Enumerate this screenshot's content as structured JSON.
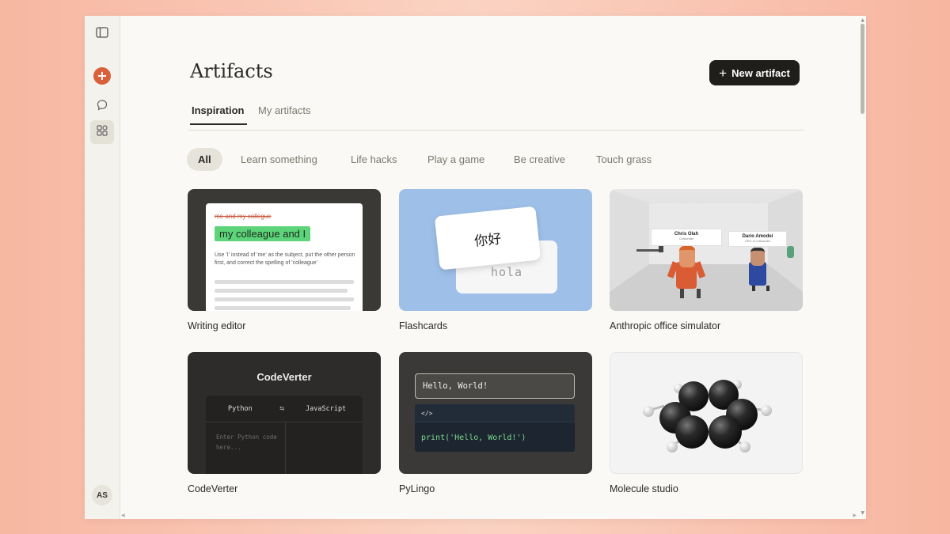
{
  "sidebar": {
    "toggle_icon": "sidebar-toggle-icon",
    "new_chat_icon": "plus-icon",
    "chats_icon": "chat-bubble-icon",
    "artifacts_icon": "artifacts-grid-icon",
    "avatar_initials": "AS",
    "accent": "#d9603d"
  },
  "header": {
    "title": "Artifacts",
    "new_button_label": "New artifact"
  },
  "tabs": [
    {
      "label": "Inspiration",
      "active": true
    },
    {
      "label": "My artifacts",
      "active": false
    }
  ],
  "filters": [
    {
      "label": "All",
      "active": true
    },
    {
      "label": "Learn something",
      "active": false
    },
    {
      "label": "Life hacks",
      "active": false
    },
    {
      "label": "Play a game",
      "active": false
    },
    {
      "label": "Be creative",
      "active": false
    },
    {
      "label": "Touch grass",
      "active": false
    }
  ],
  "cards": [
    {
      "label": "Writing editor",
      "preview": {
        "struck_text": "me and my collegue",
        "highlight_text": "my colleague and I",
        "explanation": "Use 'I' instead of 'me' as the subject, put the other person first, and correct the spelling of 'colleague'"
      }
    },
    {
      "label": "Flashcards",
      "preview": {
        "front": "你好",
        "back": "hola"
      }
    },
    {
      "label": "Anthropic office simulator",
      "preview": {
        "sign1_name": "Chris Olah",
        "sign1_role": "Cofounder",
        "sign2_name": "Dario Amodei",
        "sign2_role": "CEO & Cofounder"
      }
    },
    {
      "label": "CodeVerter",
      "preview": {
        "title": "CodeVerter",
        "from_lang": "Python",
        "swap_icon": "swap-arrows-icon",
        "to_lang": "JavaScript",
        "placeholder": "Enter Python code here..."
      }
    },
    {
      "label": "PyLingo",
      "preview": {
        "input_text": "Hello, World!",
        "code_tag": "</>",
        "code_line": "print('Hello, World!')"
      }
    },
    {
      "label": "Molecule studio",
      "preview": {
        "molecule": "benzene-3d"
      }
    }
  ]
}
